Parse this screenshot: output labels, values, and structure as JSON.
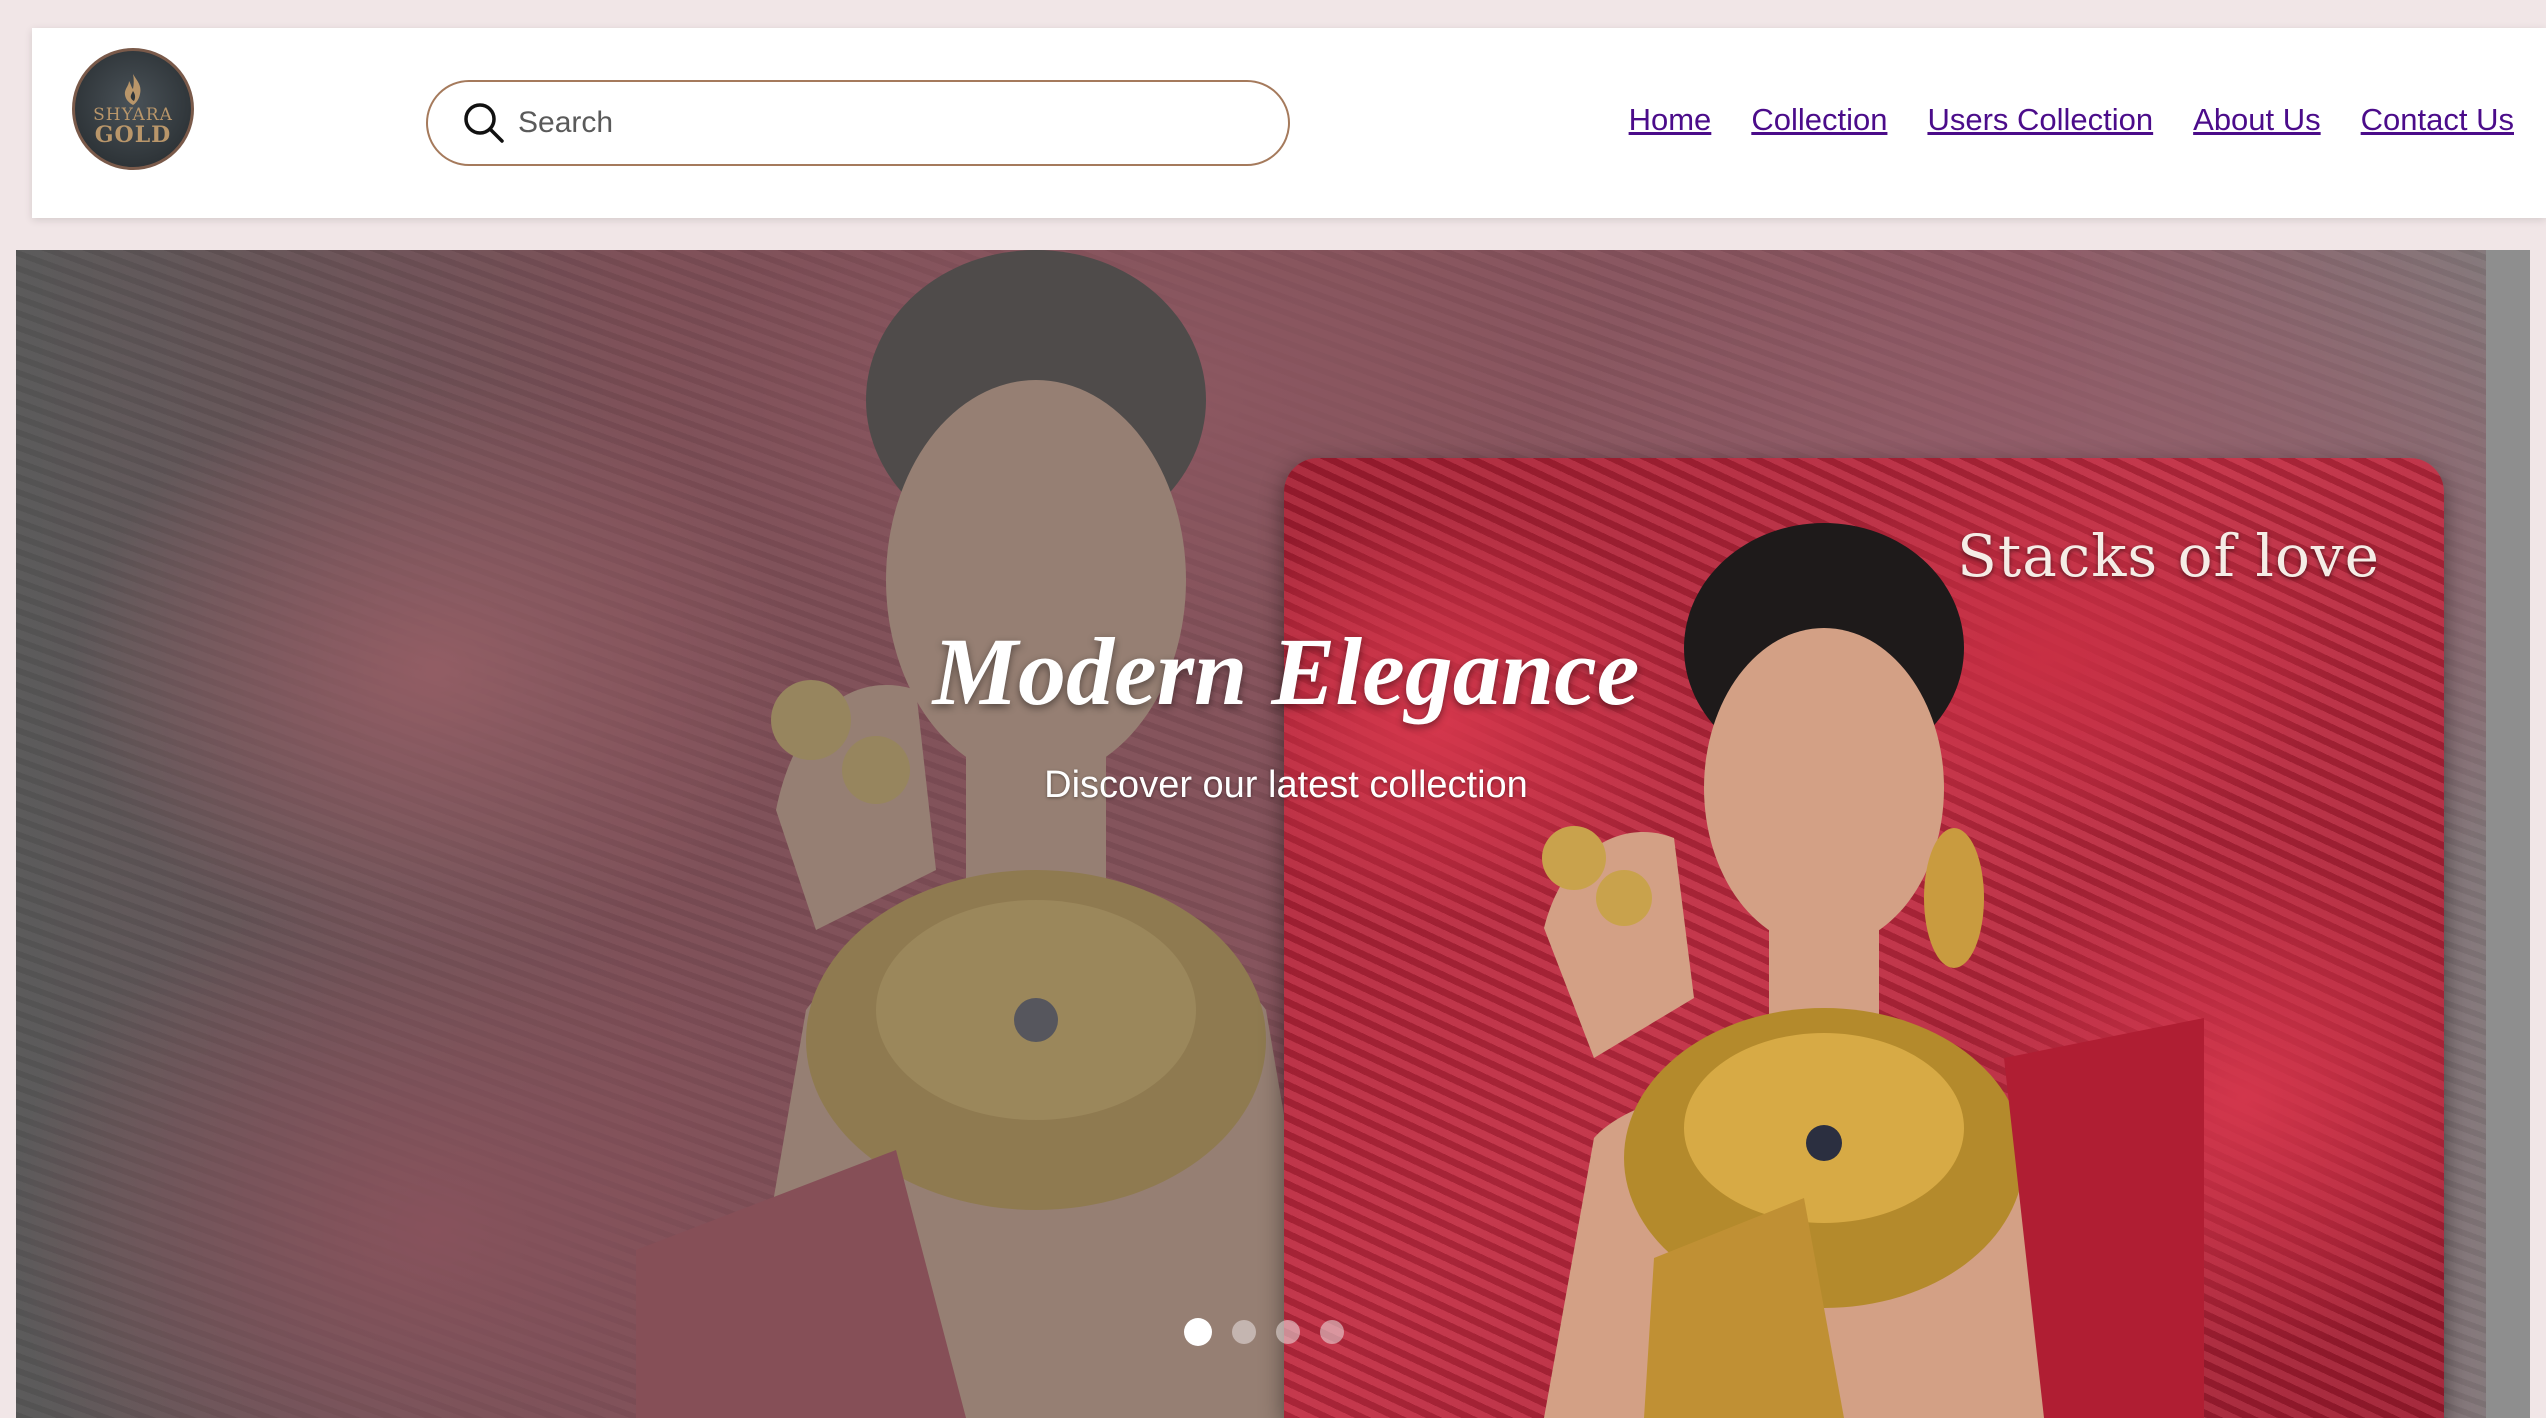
{
  "brand": {
    "logo_line1": "SHYARA",
    "logo_line2": "GOLD"
  },
  "search": {
    "placeholder": "Search",
    "value": ""
  },
  "nav": {
    "items": [
      {
        "label": "Home"
      },
      {
        "label": "Collection"
      },
      {
        "label": "Users Collection"
      },
      {
        "label": "About Us"
      },
      {
        "label": "Contact Us"
      }
    ]
  },
  "hero": {
    "title": "Modern Elegance",
    "subtitle": "Discover our latest collection",
    "card_title": "Stacks of love",
    "slides_count": 4,
    "active_slide": 1
  },
  "colors": {
    "page_bg": "#f1e6e7",
    "nav_link": "#4b0c8a",
    "search_border": "#a57a5c",
    "hero_red": "#b5263b"
  }
}
